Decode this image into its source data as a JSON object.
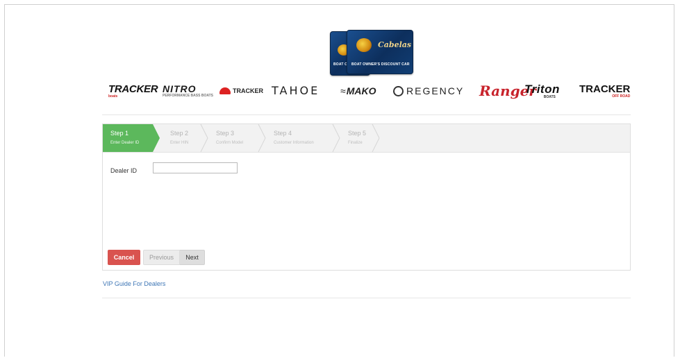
{
  "hero_card": {
    "brand_script": "Cabelas",
    "caption": "BOAT OWNER'S DISCOUNT CARD"
  },
  "brands": {
    "tracker": {
      "name": "TRACKER",
      "sub": "boats"
    },
    "nitro": {
      "name": "NITRO",
      "sub": "PERFORMANCE BASS BOATS"
    },
    "sun_tracker": {
      "name": "TRACKER"
    },
    "tahoe": {
      "name": "TAHOE"
    },
    "mako": {
      "name": "MAKO"
    },
    "regency": {
      "name": "REGENCY"
    },
    "ranger": {
      "name": "Ranger"
    },
    "triton": {
      "name": "Triton",
      "sub": "BOATS"
    },
    "tracker_off_road": {
      "name": "TRACKER",
      "sub": "OFF ROAD"
    }
  },
  "wizard": {
    "steps": [
      {
        "title": "Step 1",
        "desc": "Enter Dealer ID",
        "active": true
      },
      {
        "title": "Step 2",
        "desc": "Enter HIN",
        "active": false
      },
      {
        "title": "Step 3",
        "desc": "Confirm Model",
        "active": false
      },
      {
        "title": "Step 4",
        "desc": "Customer Information",
        "active": false
      },
      {
        "title": "Step 5",
        "desc": "Finalize",
        "active": false
      }
    ],
    "dealer_id": {
      "label": "Dealer ID",
      "value": "",
      "placeholder": ""
    },
    "buttons": {
      "cancel": "Cancel",
      "previous": "Previous",
      "next": "Next"
    }
  },
  "footer": {
    "vip_link": "VIP Guide For Dealers"
  },
  "colors": {
    "active_step": "#5cb85c",
    "cancel": "#d9534f",
    "link": "#3e76b5"
  }
}
